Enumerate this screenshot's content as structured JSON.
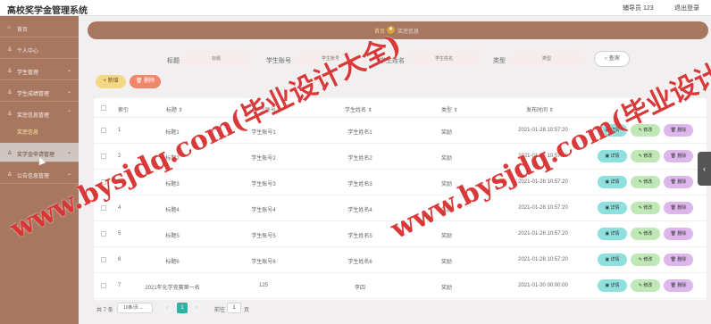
{
  "app": {
    "title": "高校奖学金管理系统"
  },
  "header": {
    "user": "辅导员 123",
    "logout": "退出登录"
  },
  "sidebar": {
    "items": [
      {
        "label": "首页",
        "icon": "home-icon",
        "arrow": ""
      },
      {
        "label": "个人中心",
        "icon": "person-icon",
        "arrow": ""
      },
      {
        "label": "学生管理",
        "icon": "user-icon",
        "arrow": "⌄"
      },
      {
        "label": "学生成绩管理",
        "icon": "user-icon",
        "arrow": "⌄"
      },
      {
        "label": "奖惩信息管理",
        "icon": "user-icon",
        "arrow": "⌃"
      },
      {
        "label": "奖学金申请管理",
        "icon": "user-icon",
        "arrow": "⌄"
      },
      {
        "label": "公告信息管理",
        "icon": "user-icon",
        "arrow": "⌄"
      }
    ],
    "sub_item": "奖惩信息"
  },
  "breadcrumb": {
    "home": "首页",
    "current": "奖惩信息"
  },
  "search": {
    "fields": [
      {
        "label": "标题",
        "placeholder": "标题"
      },
      {
        "label": "学生账号",
        "placeholder": "学生账号"
      },
      {
        "label": "学生姓名",
        "placeholder": "学生姓名"
      },
      {
        "label": "类型",
        "placeholder": "类型"
      }
    ],
    "button": "查询"
  },
  "actions": {
    "add": "新增",
    "delete": "删除"
  },
  "table": {
    "headers": [
      "索引",
      "标题",
      "学生账号",
      "学生姓名",
      "类型",
      "发布时间"
    ],
    "rows": [
      {
        "index": "1",
        "title": "标题1",
        "account": "学生账号1",
        "name": "学生姓名1",
        "type": "奖励",
        "time": "2021-01-28 10:57:20"
      },
      {
        "index": "2",
        "title": "标题2",
        "account": "学生账号2",
        "name": "学生姓名2",
        "type": "奖励",
        "time": "2021-01-28 10:57:20"
      },
      {
        "index": "3",
        "title": "标题3",
        "account": "学生账号3",
        "name": "学生姓名3",
        "type": "奖励",
        "time": "2021-01-28 10:57:20"
      },
      {
        "index": "4",
        "title": "标题4",
        "account": "学生账号4",
        "name": "学生姓名4",
        "type": "奖励",
        "time": "2021-01-28 10:57:20"
      },
      {
        "index": "5",
        "title": "标题5",
        "account": "学生账号5",
        "name": "学生姓名5",
        "type": "奖励",
        "time": "2021-01-28 10:57:20"
      },
      {
        "index": "6",
        "title": "标题6",
        "account": "学生账号6",
        "name": "学生姓名6",
        "type": "奖励",
        "time": "2021-01-28 10:57:20"
      },
      {
        "index": "7",
        "title": "2021年化学竞赛第一名",
        "account": "125",
        "name": "李四",
        "type": "奖励",
        "time": "2021-01-30 00:00:00"
      }
    ],
    "ops": {
      "detail": "详情",
      "edit": "修改",
      "delete": "删除"
    }
  },
  "pagination": {
    "total": "共 7 条",
    "page_size": "10条/页",
    "prev": "‹",
    "current": "1",
    "next": "›",
    "goto": "前往",
    "page_value": "1",
    "page_suffix": "页"
  },
  "side_tab": "‹",
  "watermark": {
    "text": "www.bysjdq.com(毕业设计大全)"
  }
}
